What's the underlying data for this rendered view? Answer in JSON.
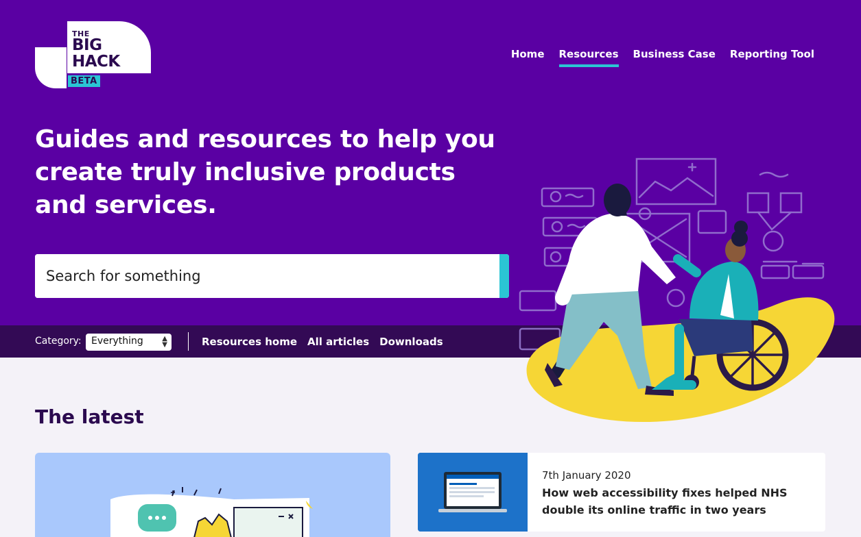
{
  "logo": {
    "the": "THE",
    "big": "BIG",
    "hack": "HACK",
    "badge": "BETA"
  },
  "nav": {
    "items": [
      {
        "label": "Home"
      },
      {
        "label": "Resources",
        "active": true
      },
      {
        "label": "Business Case"
      },
      {
        "label": "Reporting Tool"
      }
    ]
  },
  "hero": {
    "headline": "Guides and resources to help you create truly inclusive products and services."
  },
  "search": {
    "placeholder": "Search for something"
  },
  "subbar": {
    "category_label": "Category:",
    "category_value": "Everything",
    "links": [
      "Resources home",
      "All articles",
      "Downloads"
    ]
  },
  "latest": {
    "heading": "The latest",
    "articles": [
      {
        "date": "7th January 2020",
        "title": "How web accessibility fixes helped NHS double its online traffic in two years"
      }
    ]
  },
  "colors": {
    "hero_bg": "#5a00a3",
    "subbar_bg": "#330a55",
    "accent": "#2bc5d4",
    "heading": "#2b0a4f",
    "page_bg": "#f4f2f8",
    "yellow": "#f6d635"
  }
}
